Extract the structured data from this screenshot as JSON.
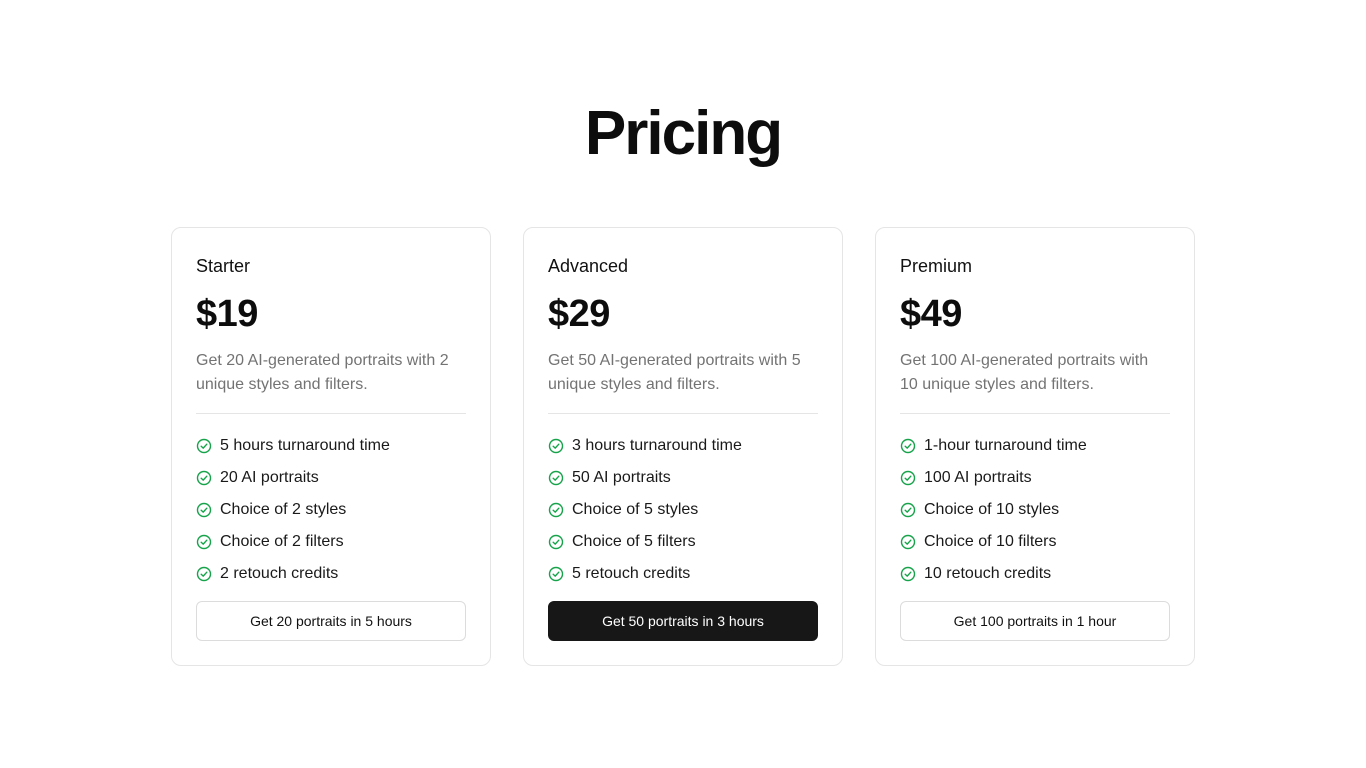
{
  "page": {
    "title": "Pricing"
  },
  "colors": {
    "check": "#16a34a",
    "primary_button": "#171717"
  },
  "plans": [
    {
      "name": "Starter",
      "price": "$19",
      "description": "Get 20 AI-generated portraits with 2 unique styles and filters.",
      "features": [
        "5 hours turnaround time",
        "20 AI portraits",
        "Choice of 2 styles",
        "Choice of 2 filters",
        "2 retouch credits"
      ],
      "cta": "Get 20 portraits in 5 hours"
    },
    {
      "name": "Advanced",
      "price": "$29",
      "description": "Get 50 AI-generated portraits with 5 unique styles and filters.",
      "features": [
        "3 hours turnaround time",
        "50 AI portraits",
        "Choice of 5 styles",
        "Choice of 5 filters",
        "5 retouch credits"
      ],
      "cta": "Get 50 portraits in 3 hours"
    },
    {
      "name": "Premium",
      "price": "$49",
      "description": "Get 100 AI-generated portraits with 10 unique styles and filters.",
      "features": [
        "1-hour turnaround time",
        "100 AI portraits",
        "Choice of 10 styles",
        "Choice of 10 filters",
        "10 retouch credits"
      ],
      "cta": "Get 100 portraits in 1 hour"
    }
  ]
}
